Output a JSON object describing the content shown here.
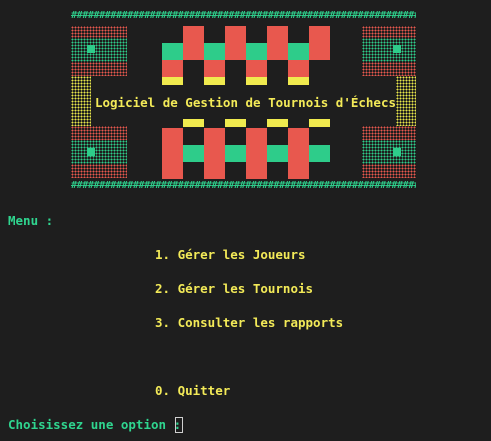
{
  "banner": {
    "hash_line": "##########################################################################",
    "title": "Logiciel de Gestion de Tournois d'Échecs",
    "colors": {
      "red": "#e8584e",
      "green": "#2ecc8a",
      "yellow": "#f0ea4e"
    }
  },
  "menu": {
    "label": "Menu :",
    "options": [
      "1. Gérer les Joueurs",
      "2. Gérer les Tournois",
      "3. Consulter les rapports",
      "0. Quitter"
    ]
  },
  "prompt": {
    "text": "Choisissez une option : "
  }
}
